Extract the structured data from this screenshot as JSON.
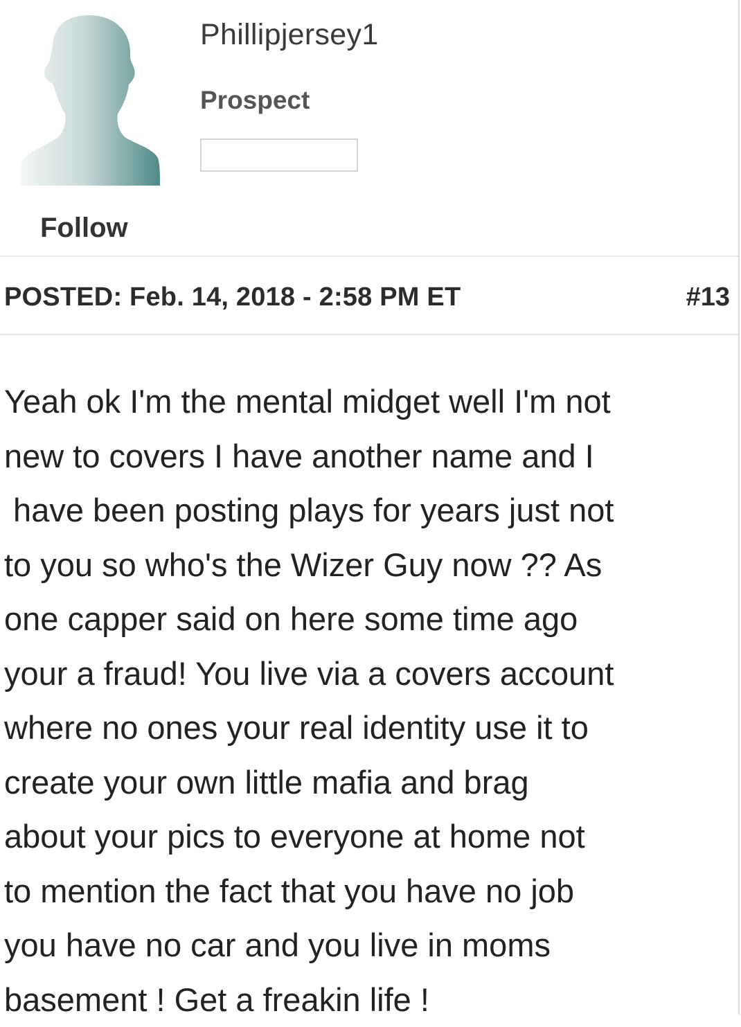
{
  "user": {
    "name": "Phillipjersey1",
    "rank": "Prospect",
    "follow_label": "Follow",
    "avatar_icon": "default-user-silhouette-icon"
  },
  "post": {
    "posted": "POSTED: Feb. 14, 2018 - 2:58 PM ET",
    "number": "#13",
    "lines": [
      "Yeah ok I'm the mental midget well I'm not",
      "new to covers I have another name and I",
      " have been posting plays for years just not",
      "to you so who's the Wizer Guy now ?? As",
      "one capper said on here some time ago",
      "your a fraud! You live via a covers account",
      "where no ones your real identity use it to",
      "create your own little mafia and brag",
      "about your pics to everyone at home not",
      "to mention the fact that you have no job",
      "you have no car and you live in moms",
      "basement ! Get a freakin life !"
    ]
  },
  "colors": {
    "avatar_light": "#eef2f2",
    "avatar_dark": "#4f8a89",
    "divider": "#e6e6e6",
    "text": "#222222"
  }
}
